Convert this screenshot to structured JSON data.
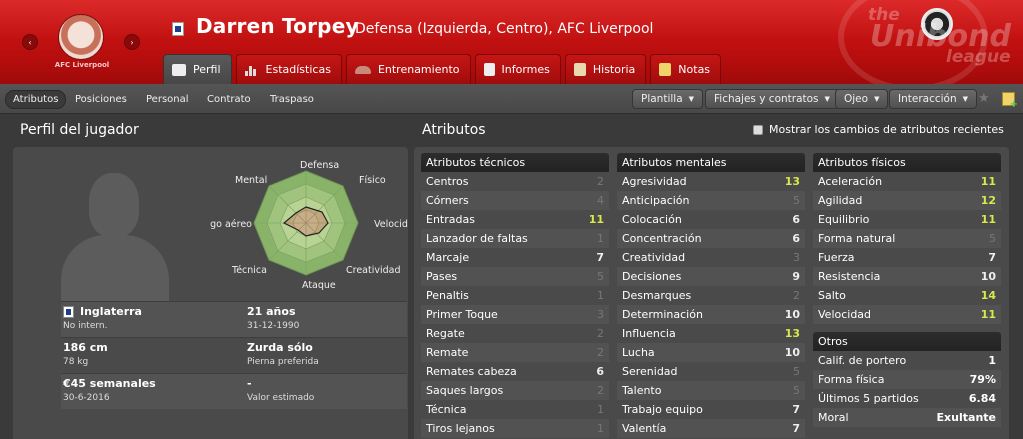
{
  "header": {
    "club_name": "AFC Liverpool",
    "player_name": "Darren Torpey",
    "subtitle": "Defensa (Izquierda, Centro), AFC Liverpool",
    "league_logo_text": [
      "the",
      "Unibond",
      "league"
    ],
    "prev_icon": "‹",
    "next_icon": "›",
    "colors": {
      "brand_red": "#c41212",
      "header_dark": "#a00a0a"
    }
  },
  "tabs": [
    {
      "label": "Perfil",
      "icon": "profile-card-icon",
      "active": true
    },
    {
      "label": "Estadísticas",
      "icon": "bar-chart-icon",
      "active": false
    },
    {
      "label": "Entrenamiento",
      "icon": "boot-icon",
      "active": false
    },
    {
      "label": "Informes",
      "icon": "report-icon",
      "active": false
    },
    {
      "label": "Historia",
      "icon": "history-icon",
      "active": false
    },
    {
      "label": "Notas",
      "icon": "notes-icon",
      "active": false
    }
  ],
  "subnav": {
    "items": [
      "Atributos",
      "Posiciones",
      "Personal",
      "Contrato",
      "Traspaso"
    ],
    "active": "Atributos",
    "dropdowns": [
      "Plantilla",
      "Fichajes y contratos",
      "Ojeo",
      "Interacción"
    ]
  },
  "profile": {
    "title": "Perfil del jugador",
    "radar_labels": {
      "defensa": "Defensa",
      "fisico": "Físico",
      "velocidad": "Velocidad",
      "creatividad": "Creatividad",
      "ataque": "Ataque",
      "tecnica": "Técnica",
      "juego_aereo": "Juego aéreo",
      "mental": "Mental"
    },
    "info": [
      {
        "main": "Inglaterra",
        "sub": "No intern."
      },
      {
        "main": "21 años",
        "sub": "31-12-1990"
      },
      {
        "main": "186 cm",
        "sub": "78 kg"
      },
      {
        "main": "Zurda sólo",
        "sub": "Pierna preferida"
      },
      {
        "main": "€45 semanales",
        "sub": "30-6-2016"
      },
      {
        "main": "-",
        "sub": "Valor estimado"
      }
    ]
  },
  "attributes": {
    "title": "Atributos",
    "show_changes_label": "Mostrar los cambios de atributos recientes",
    "technical": {
      "title": "Atributos técnicos",
      "rows": [
        {
          "name": "Centros",
          "value": "2"
        },
        {
          "name": "Córners",
          "value": "4"
        },
        {
          "name": "Entradas",
          "value": "11"
        },
        {
          "name": "Lanzador de faltas",
          "value": "1"
        },
        {
          "name": "Marcaje",
          "value": "7"
        },
        {
          "name": "Pases",
          "value": "5"
        },
        {
          "name": "Penaltis",
          "value": "1"
        },
        {
          "name": "Primer Toque",
          "value": "3"
        },
        {
          "name": "Regate",
          "value": "2"
        },
        {
          "name": "Remate",
          "value": "2"
        },
        {
          "name": "Remates cabeza",
          "value": "6"
        },
        {
          "name": "Saques largos",
          "value": "2"
        },
        {
          "name": "Técnica",
          "value": "1"
        },
        {
          "name": "Tiros lejanos",
          "value": "1"
        }
      ]
    },
    "mental": {
      "title": "Atributos mentales",
      "rows": [
        {
          "name": "Agresividad",
          "value": "13"
        },
        {
          "name": "Anticipación",
          "value": "5"
        },
        {
          "name": "Colocación",
          "value": "6"
        },
        {
          "name": "Concentración",
          "value": "6"
        },
        {
          "name": "Creatividad",
          "value": "3"
        },
        {
          "name": "Decisiones",
          "value": "9"
        },
        {
          "name": "Desmarques",
          "value": "2"
        },
        {
          "name": "Determinación",
          "value": "10"
        },
        {
          "name": "Influencia",
          "value": "13"
        },
        {
          "name": "Lucha",
          "value": "10"
        },
        {
          "name": "Serenidad",
          "value": "5"
        },
        {
          "name": "Talento",
          "value": "5"
        },
        {
          "name": "Trabajo equipo",
          "value": "7"
        },
        {
          "name": "Valentía",
          "value": "7"
        }
      ]
    },
    "physical": {
      "title": "Atributos físicos",
      "rows": [
        {
          "name": "Aceleración",
          "value": "11"
        },
        {
          "name": "Agilidad",
          "value": "12"
        },
        {
          "name": "Equilibrio",
          "value": "11"
        },
        {
          "name": "Forma natural",
          "value": "5"
        },
        {
          "name": "Fuerza",
          "value": "7"
        },
        {
          "name": "Resistencia",
          "value": "10"
        },
        {
          "name": "Salto",
          "value": "14"
        },
        {
          "name": "Velocidad",
          "value": "11"
        }
      ]
    },
    "other": {
      "title": "Otros",
      "rows": [
        {
          "name": "Calif. de portero",
          "value": "1"
        },
        {
          "name": "Forma física",
          "value": "79%"
        },
        {
          "name": "Últimos 5 partidos",
          "value": "6.84"
        },
        {
          "name": "Moral",
          "value": "Exultante"
        }
      ]
    }
  }
}
